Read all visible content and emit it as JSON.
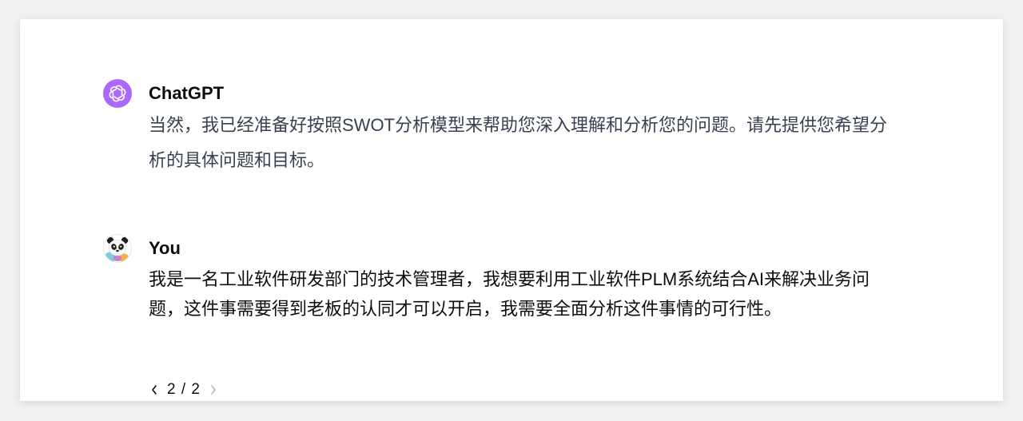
{
  "conversation": {
    "assistant": {
      "author": "ChatGPT",
      "text": "当然，我已经准备好按照SWOT分析模型来帮助您深入理解和分析您的问题。请先提供您希望分析的具体问题和目标。",
      "avatar_icon": "openai-logo-icon",
      "avatar_color": "#ab68ff"
    },
    "user": {
      "author": "You",
      "text": "我是一名工业软件研发部门的技术管理者，我想要利用工业软件PLM系统结合AI来解决业务问题，这件事需要得到老板的认同才可以开启，我需要全面分析这件事情的可行性。",
      "avatar_icon": "panda-avatar-icon",
      "pager": {
        "text": "2 / 2",
        "prev_icon": "chevron-left-icon",
        "next_icon": "chevron-right-icon"
      }
    }
  }
}
